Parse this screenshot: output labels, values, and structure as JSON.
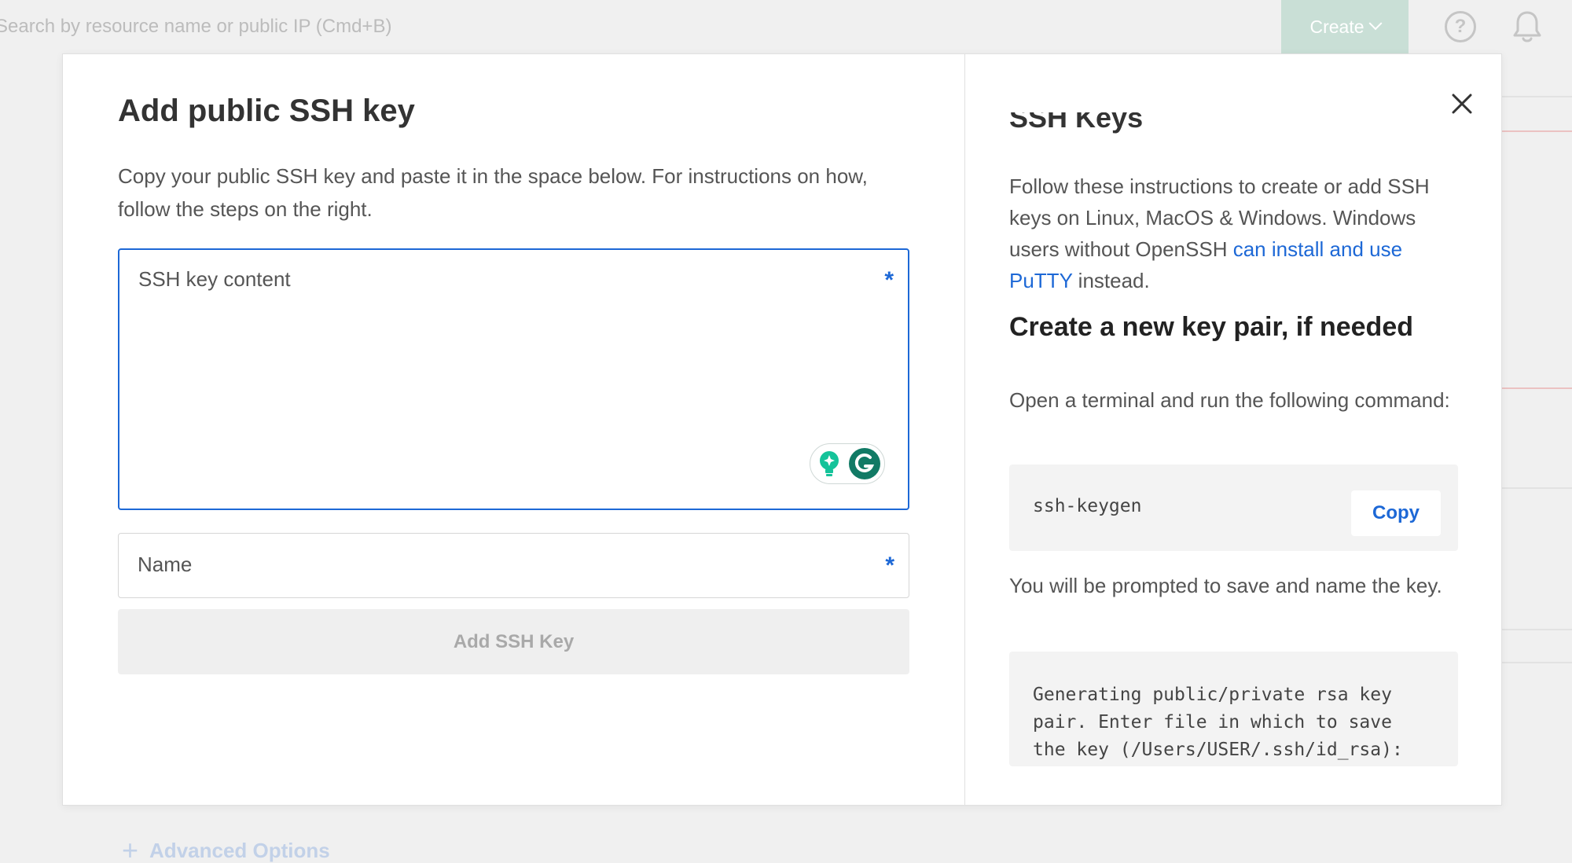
{
  "background": {
    "search_placeholder": "Search by resource name or public IP (Cmd+B)",
    "create_label": "Create",
    "help_icon_label": "?",
    "advanced_options_label": "Advanced Options",
    "plus_glyph": "+"
  },
  "modal": {
    "title": "Add public SSH key",
    "intro": "Copy your public SSH key and paste it in the space below. For instructions on how, follow the steps on the right.",
    "ssh_key_field": {
      "label": "SSH key content",
      "value": "",
      "required_mark": "*"
    },
    "name_field": {
      "label": "Name",
      "value": "",
      "required_mark": "*"
    },
    "submit_label": "Add SSH Key",
    "close_label": "×"
  },
  "help_panel": {
    "heading": "SSH Keys",
    "instructions_prefix": "Follow these instructions to create or add SSH keys on Linux, MacOS & Windows. Windows users without OpenSSH ",
    "instructions_link": "can install and use PuTTY",
    "instructions_suffix": " instead.",
    "subheading": "Create a new key pair, if needed",
    "step1_text": "Open a terminal and run the following command:",
    "command": "ssh-keygen",
    "copy_label": "Copy",
    "step2_text": "You will be prompted to save and name the key.",
    "output_text": "Generating public/private rsa key\npair. Enter file in which to save\nthe key (/Users/USER/.ssh/id_rsa):"
  },
  "colors": {
    "accent_blue": "#1d68d6",
    "create_button_bg": "#c9dfd6",
    "grammarly_green": "#15c39a",
    "disabled_text": "#a9a9a9"
  },
  "icons": [
    "help-icon",
    "bell-icon",
    "chevron-down-icon",
    "close-icon",
    "grammarly-icon",
    "lightbulb-icon",
    "plus-icon"
  ]
}
